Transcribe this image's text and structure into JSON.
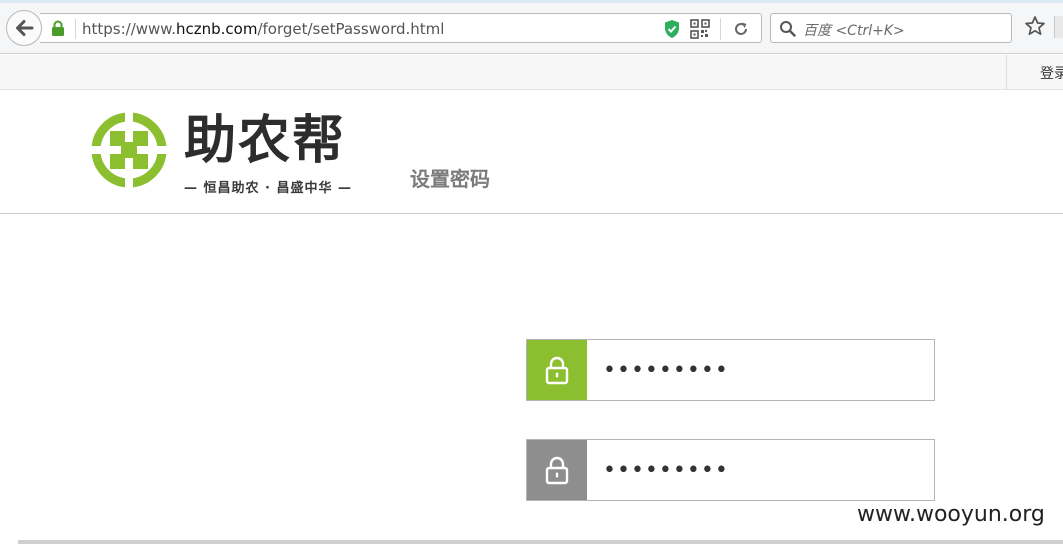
{
  "browser": {
    "url_prefix": "https://www.",
    "url_host": "hcznb.com",
    "url_path": "/forget/setPassword.html",
    "search_placeholder": "百度 <Ctrl+K>"
  },
  "topbar": {
    "login_label": "登录"
  },
  "header": {
    "brand_name": "助农帮",
    "slogan": "— 恒昌助农 · 昌盛中华 —",
    "page_title": "设置密码"
  },
  "form": {
    "password_value": "123456789",
    "confirm_password_value": "123456789"
  },
  "colors": {
    "accent_green": "#8cbf2f",
    "icon_gray": "#8e8e8e"
  },
  "icons": [
    "back-arrow-icon",
    "lock-icon",
    "shield-icon",
    "qr-code-icon",
    "reload-icon",
    "search-icon",
    "star-icon",
    "padlock-icon"
  ],
  "watermark": "www.wooyun.org"
}
